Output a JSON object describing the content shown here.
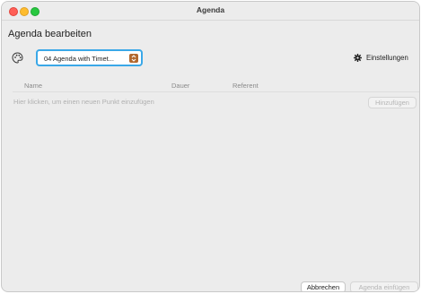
{
  "window": {
    "title": "Agenda",
    "traffic_lights": {
      "close": "#ff5f57",
      "minimize": "#febc2e",
      "maximize": "#28c840"
    }
  },
  "header": {
    "heading": "Agenda bearbeiten"
  },
  "toolbar": {
    "palette_icon": "palette-icon",
    "template_select_value": "04 Agenda with Timet...",
    "settings_icon": "gear-icon",
    "settings_label": "Einstellungen"
  },
  "table": {
    "columns": [
      "Name",
      "Dauer",
      "Referent"
    ],
    "empty_hint": "Hier klicken, um einen neuen Punkt einzufügen",
    "add_label": "Hinzufügen"
  },
  "footer": {
    "cancel_label": "Abbrechen",
    "insert_label": "Agenda einfügen"
  },
  "colors": {
    "focus_ring": "#3aa8e8",
    "select_arrow": "#b2682f"
  }
}
